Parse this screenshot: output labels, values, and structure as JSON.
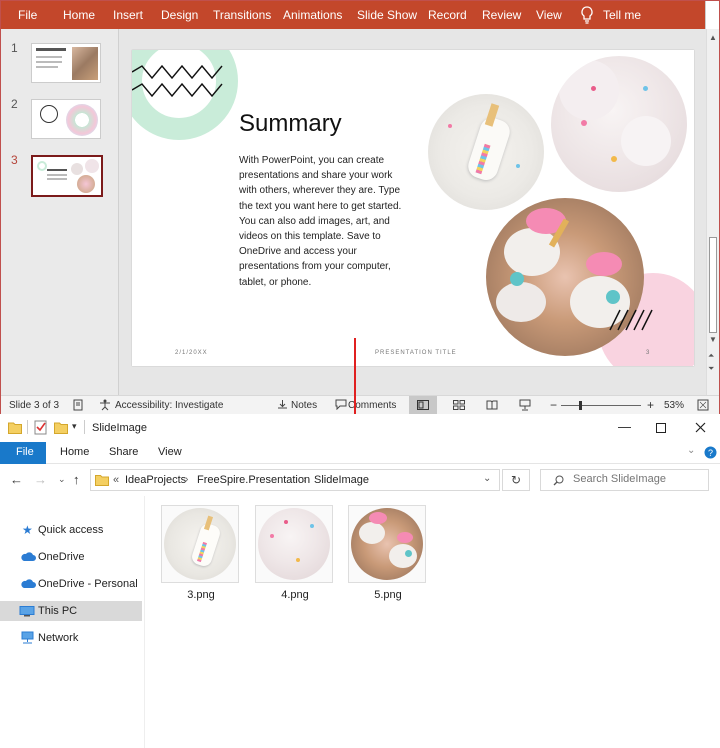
{
  "ppt": {
    "ribbon": [
      "File",
      "Home",
      "Insert",
      "Design",
      "Transitions",
      "Animations",
      "Slide Show",
      "Record",
      "Review",
      "View",
      "Tell me"
    ],
    "thumbs": [
      {
        "num": "1"
      },
      {
        "num": "2"
      },
      {
        "num": "3"
      }
    ],
    "slide": {
      "title": "Summary",
      "body": "With PowerPoint, you can create presentations and share your work with others, wherever they are. Type the text you want here to get started. You can also add images, art, and videos on this template. Save to OneDrive and access your presentations from your computer, tablet, or phone.",
      "footer_date": "2/1/20XX",
      "footer_title": "PRESENTATION TITLE",
      "footer_page": "3"
    },
    "status": {
      "slide": "Slide 3 of 3",
      "accessibility": "Accessibility: Investigate",
      "notes": "Notes",
      "comments": "Comments",
      "zoom": "53%"
    },
    "colors": {
      "ribbon": "#c3472b",
      "accent": "#7b1a1a",
      "mint": "#c9ecd9",
      "pink": "#f9d3e0"
    }
  },
  "explorer": {
    "title": "SlideImage",
    "tabs": [
      "File",
      "Home",
      "Share",
      "View"
    ],
    "breadcrumb": [
      "IdeaProjects",
      "FreeSpire.Presentation",
      "SlideImage"
    ],
    "breadcrumb_prefix": "«",
    "search_placeholder": "Search SlideImage",
    "nav": [
      "Quick access",
      "OneDrive",
      "OneDrive - Personal",
      "This PC",
      "Network"
    ],
    "files": [
      "3.png",
      "4.png",
      "5.png"
    ]
  }
}
